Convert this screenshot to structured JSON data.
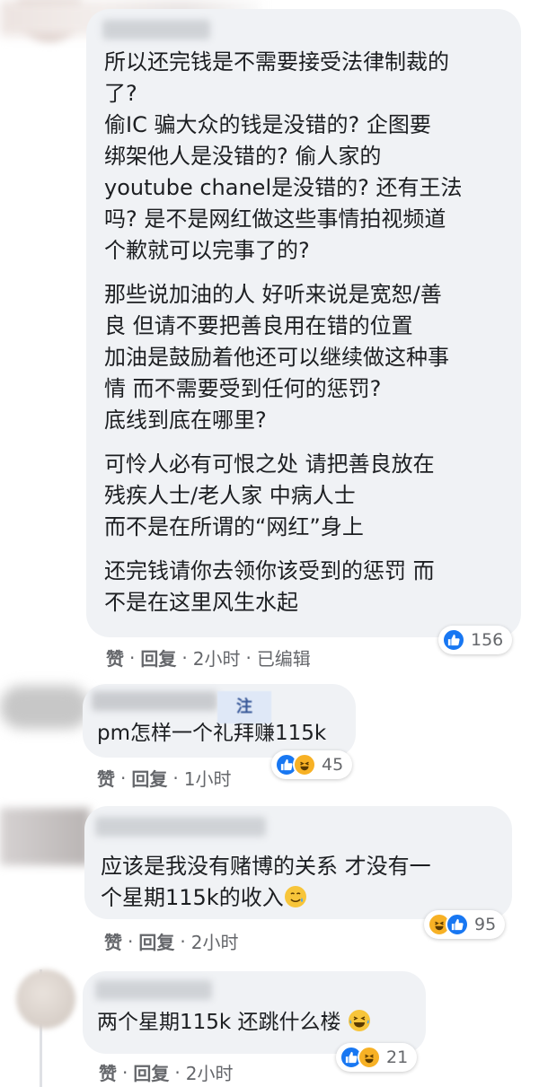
{
  "comments": [
    {
      "paragraphs": [
        "所以还完钱是不需要接受法律制裁的\n了?\n偷IC 骗大众的钱是没错的? 企图要\n绑架他人是没错的? 偷人家的\nyoutube chanel是没错的? 还有王法\n吗? 是不是网红做这些事情拍视频道\n个歉就可以完事了的?",
        "那些说加油的人 好听来说是宽恕/善\n良 但请不要把善良用在错的位置\n加油是鼓励着他还可以继续做这种事\n情 而不需要受到任何的惩罚?\n底线到底在哪里?",
        "可怜人必有可恨之处 请把善良放在\n残疾人士/老人家 中病人士\n而不是在所谓的“网红”身上",
        "还完钱请你去领你该受到的惩罚 而\n不是在这里风生水起"
      ],
      "like_label": "赞",
      "reply_label": "回复",
      "time": "2小时",
      "edited": "已编辑",
      "reaction_count": "156",
      "reaction_types": [
        "like-icon"
      ]
    },
    {
      "author_partial": "注",
      "paragraphs": [
        "pm怎样一个礼拜赚115k"
      ],
      "like_label": "赞",
      "reply_label": "回复",
      "time": "1小时",
      "reaction_count": "45",
      "reaction_types": [
        "like-icon",
        "haha-icon"
      ]
    },
    {
      "paragraphs": [
        "应该是我没有赌博的关系 才没有一\n个星期115k的收入"
      ],
      "trailing_emoji": "crying-smile-emoji",
      "like_label": "赞",
      "reply_label": "回复",
      "time": "2小时",
      "reaction_count": "95",
      "reaction_types": [
        "haha-icon",
        "like-icon"
      ]
    },
    {
      "paragraphs": [
        "两个星期115k 还跳什么楼"
      ],
      "trailing_emoji": "laughing-tears-emoji",
      "like_label": "赞",
      "reply_label": "回复",
      "time": "2小时",
      "reaction_count": "21",
      "reaction_types": [
        "like-icon",
        "haha-icon"
      ]
    }
  ],
  "colors": {
    "bubble": "#f0f2f5",
    "like_blue": "#1877f2",
    "haha_yellow": "#f7b125",
    "meta_gray": "#65676b"
  }
}
